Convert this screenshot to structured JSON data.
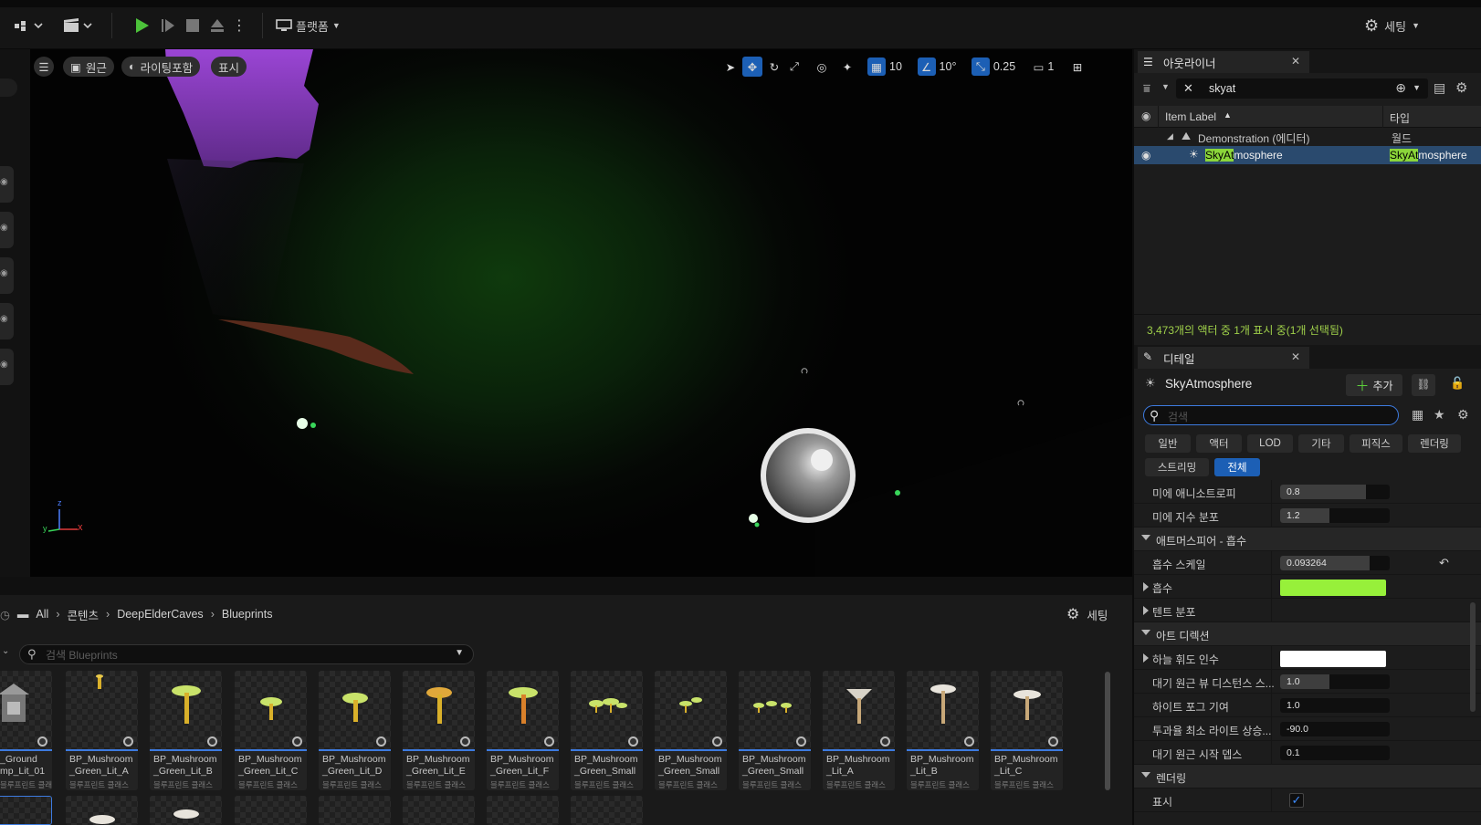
{
  "toolbar": {
    "platform_label": "플랫폼",
    "settings_label": "세팅"
  },
  "viewport": {
    "perspective_label": "원근",
    "lit_label": "라이팅포함",
    "show_label": "표시",
    "grid_snap": "10",
    "rotate_snap": "10°",
    "scale_snap": "0.25",
    "camera_speed": "1",
    "axis_x": "x",
    "axis_y": "y",
    "axis_z": "z"
  },
  "content_browser": {
    "crumbs": [
      "All",
      "콘텐츠",
      "DeepElderCaves",
      "Blueprints"
    ],
    "settings_label": "세팅",
    "search_placeholder": "검색 Blueprints",
    "assets": [
      {
        "line1": "_Ground",
        "line2": "mp_Lit_01",
        "type": "블루프린트 클래스"
      },
      {
        "line1": "BP_Mushroom",
        "line2": "_Green_Lit_A",
        "type": "블루프린트 클래스"
      },
      {
        "line1": "BP_Mushroom",
        "line2": "_Green_Lit_B",
        "type": "블루프린트 클래스"
      },
      {
        "line1": "BP_Mushroom",
        "line2": "_Green_Lit_C",
        "type": "블루프린트 클래스"
      },
      {
        "line1": "BP_Mushroom",
        "line2": "_Green_Lit_D",
        "type": "블루프린트 클래스"
      },
      {
        "line1": "BP_Mushroom",
        "line2": "_Green_Lit_E",
        "type": "블루프린트 클래스"
      },
      {
        "line1": "BP_Mushroom",
        "line2": "_Green_Lit_F",
        "type": "블루프린트 클래스"
      },
      {
        "line1": "BP_Mushroom",
        "line2": "_Green_Small",
        "type": "블루프린트 클래스"
      },
      {
        "line1": "BP_Mushroom",
        "line2": "_Green_Small",
        "type": "블루프린트 클래스"
      },
      {
        "line1": "BP_Mushroom",
        "line2": "_Green_Small",
        "type": "블루프린트 클래스"
      },
      {
        "line1": "BP_Mushroom",
        "line2": "_Lit_A",
        "type": "블루프린트 클래스"
      },
      {
        "line1": "BP_Mushroom",
        "line2": "_Lit_B",
        "type": "블루프린트 클래스"
      },
      {
        "line1": "BP_Mushroom",
        "line2": "_Lit_C",
        "type": "블루프린트 클래스"
      }
    ]
  },
  "outliner": {
    "tab_title": "아웃라이너",
    "search_value": "skyat",
    "col_label": "Item Label",
    "col_type": "타입",
    "rows": [
      {
        "label": "Demonstration (에디터)",
        "type": "월드"
      },
      {
        "label_match": "SkyAt",
        "label_rest": "mosphere",
        "type_match": "SkyAt",
        "type_rest": "mosphere"
      }
    ],
    "status": "3,473개의 액터 중 1개 표시 중(1개 선택됨)"
  },
  "details": {
    "tab_title": "디테일",
    "actor_name": "SkyAtmosphere",
    "add_label": "추가",
    "search_placeholder": "검색",
    "categories": [
      "일반",
      "액터",
      "LOD",
      "기타",
      "피직스",
      "렌더링",
      "스트리밍",
      "전체"
    ],
    "props": {
      "mie_anisotropy": {
        "label": "미에 애니소트로피",
        "value": "0.8",
        "fill": 0.78
      },
      "mie_exp": {
        "label": "미에 지수 분포",
        "value": "1.2",
        "fill": 0.45
      },
      "absorption_section": "애트머스피어 - 흡수",
      "absorption_scale": {
        "label": "흡수 스케일",
        "value": "0.093264",
        "fill": 0.82
      },
      "absorption": {
        "label": "흡수",
        "color": "#97f03a"
      },
      "tent": {
        "label": "텐트 분포"
      },
      "art_section": "아트 디렉션",
      "sky_luminance": {
        "label": "하늘 휘도 인수",
        "color": "#ffffff"
      },
      "aerial_view": {
        "label": "대기 원근 뷰 디스턴스 스...",
        "value": "1.0",
        "fill": 0.45
      },
      "height_fog": {
        "label": "하이트 포그 기여",
        "value": "1.0",
        "fill": 0.0
      },
      "transmittance": {
        "label": "투과율 최소 라이트 상승...",
        "value": "-90.0",
        "fill": 0.0
      },
      "aerial_start": {
        "label": "대기 원근 시작 뎁스",
        "value": "0.1",
        "fill": 0.0
      },
      "render_section": "렌더링",
      "visible": {
        "label": "표시",
        "checked": true
      }
    }
  }
}
